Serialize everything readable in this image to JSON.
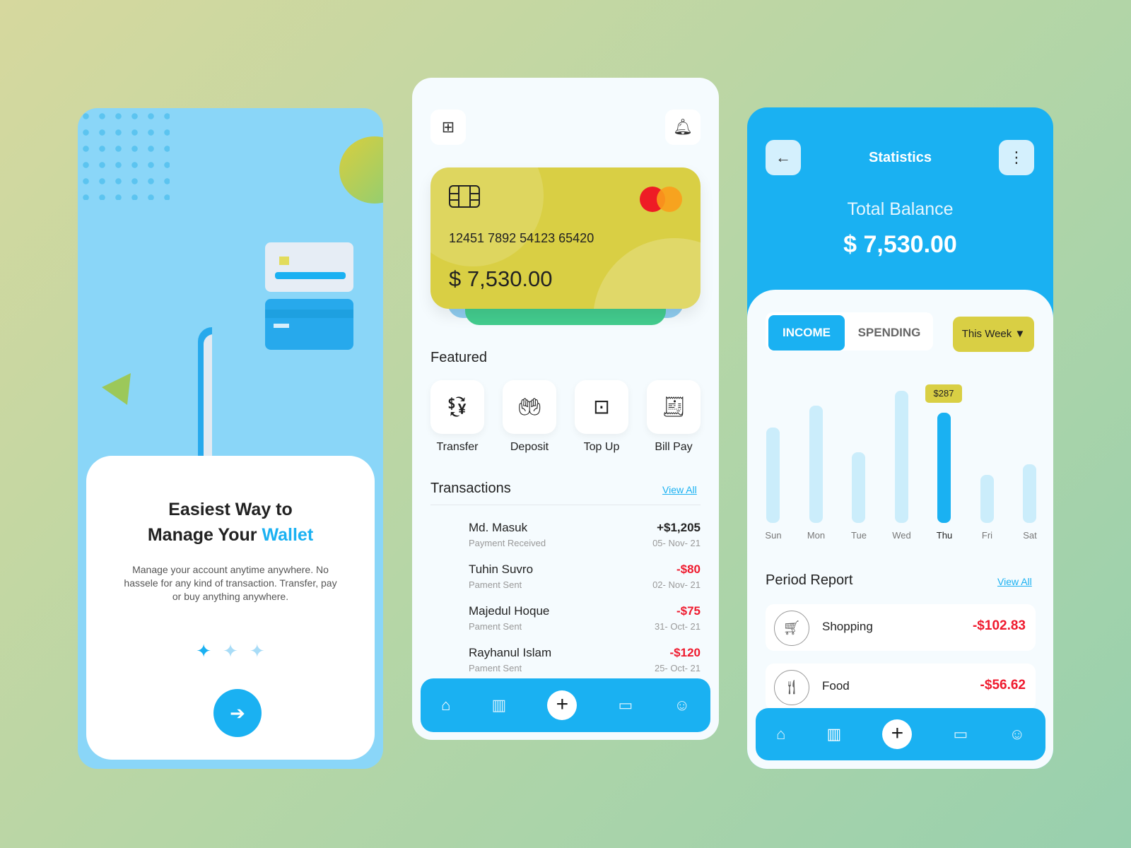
{
  "onboarding": {
    "title_line1": "Easiest Way to",
    "title_line2": "Manage Your ",
    "title_highlight": "Wallet",
    "description": "Manage your account anytime anywhere. No hassele for any kind of transaction. Transfer, pay or buy anything anywhere.",
    "next_icon": "arrow-right-icon"
  },
  "home": {
    "card": {
      "number": "12451 7892 54123 65420",
      "balance": "$ 7,530.00"
    },
    "featured_title": "Featured",
    "featured": [
      {
        "label": "Transfer",
        "icon": "transfer-icon"
      },
      {
        "label": "Deposit",
        "icon": "deposit-icon"
      },
      {
        "label": "Top Up",
        "icon": "top-up-icon"
      },
      {
        "label": "Bill Pay",
        "icon": "bill-pay-icon"
      }
    ],
    "transactions_title": "Transactions",
    "view_all": "View All",
    "transactions": [
      {
        "name": "Md. Masuk",
        "type": "Payment Received",
        "amount": "+$1,205",
        "date": "05- Nov- 21",
        "color": "#222222"
      },
      {
        "name": "Tuhin Suvro",
        "type": "Pament Sent",
        "amount": "-$80",
        "date": "02- Nov- 21",
        "color": "#ef1a2e"
      },
      {
        "name": "Majedul Hoque",
        "type": "Pament Sent",
        "amount": "-$75",
        "date": "31- Oct- 21",
        "color": "#ef1a2e"
      },
      {
        "name": "Rayhanul Islam",
        "type": "Pament Sent",
        "amount": "-$120",
        "date": "25- Oct- 21",
        "color": "#ef1a2e"
      }
    ]
  },
  "stats": {
    "title": "Statistics",
    "total_label": "Total Balance",
    "total": "$ 7,530.00",
    "tabs": [
      "INCOME",
      "SPENDING"
    ],
    "period": "This Week",
    "period_report": "Period Report",
    "view_all": "View All",
    "report": [
      {
        "label": "Shopping",
        "amount": "-$102.83",
        "icon": "cart-icon"
      },
      {
        "label": "Food",
        "amount": "-$56.62",
        "icon": "fork-knife-icon"
      }
    ]
  },
  "chart_data": {
    "type": "bar",
    "categories": [
      "Sun",
      "Mon",
      "Tue",
      "Wed",
      "Thu",
      "Fri",
      "Sat"
    ],
    "values": [
      248,
      305,
      184,
      344,
      287,
      125,
      153
    ],
    "highlight": "Thu",
    "highlight_label": "$287",
    "colors": {
      "normal": "#cbedfb",
      "highlight": "#1ab1f2",
      "tooltip": "#d9cf44"
    }
  },
  "colors": {
    "accent": "#1ab1f2",
    "card": "#d9cf44",
    "negative": "#ef1a2e"
  }
}
